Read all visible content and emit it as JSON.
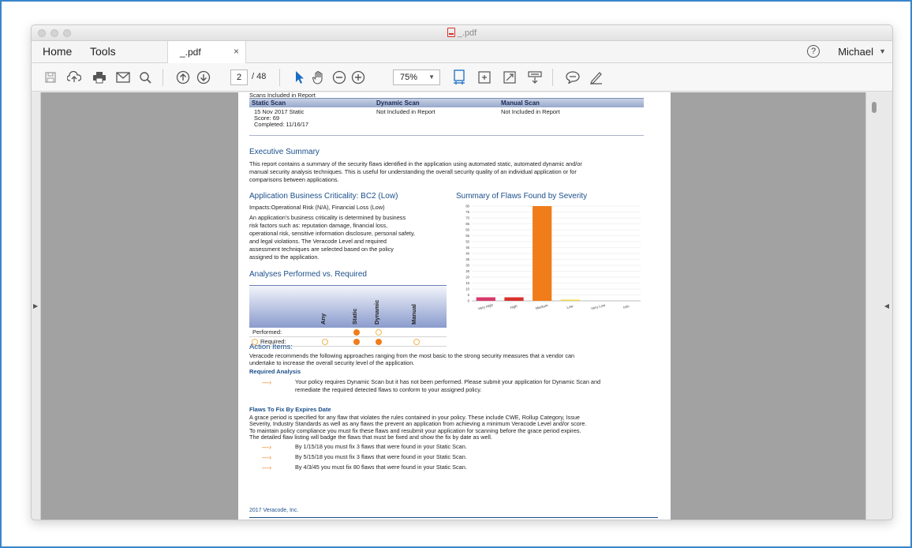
{
  "window": {
    "title": "_.pdf"
  },
  "nav": {
    "home": "Home",
    "tools": "Tools",
    "tab_label": "_.pdf",
    "tab_close": "×",
    "user": "Michael"
  },
  "toolbar": {
    "page_current": "2",
    "page_total": "/ 48",
    "zoom": "75%"
  },
  "document": {
    "scans_caption": "Scans Included in Report",
    "scan_headers": [
      "Static Scan",
      "Dynamic Scan",
      "Manual Scan"
    ],
    "static_scan_lines": [
      "15 Nov 2017 Static",
      "Score: 69",
      "Completed: 11/16/17"
    ],
    "dynamic_scan": "Not Included in Report",
    "manual_scan": "Not Included in Report",
    "exec_title": "Executive Summary",
    "exec_lines": [
      "This report contains a summary of the security flaws identified in the application using automated static, automated dynamic and/or",
      "manual security analysis techniques. This is useful for understanding the overall security quality of an individual application or for",
      "comparisons between applications."
    ],
    "criticality_title": "Application Business Criticality: BC2 (Low)",
    "impacts": "Impacts:Operational Risk (N/A), Financial Loss (Low)",
    "criticality_lines": [
      "An application's business criticality is determined by business",
      "risk factors such as: reputation damage, financial loss,",
      "operational risk, sensitive information disclosure, personal safety,",
      "and legal violations. The Veracode Level and required",
      "assessment techniques are selected based on the policy",
      "assigned to the application."
    ],
    "analyses_title": "Analyses Performed vs. Required",
    "analyses_cols": [
      "Any",
      "Static",
      "Dynamic",
      "Manual"
    ],
    "analyses_rows": [
      "Performed:",
      "Required:"
    ],
    "flaws_title": "Summary of Flaws Found by Severity",
    "action_title": "Action Items:",
    "action_lines": [
      "Veracode recommends the following approaches ranging from the most basic to the strong security measures that a vendor can",
      "undertake to increase the overall security level of the application."
    ],
    "required_analysis_title": "Required Analysis",
    "required_analysis_lines": [
      "Your policy requires Dynamic Scan but it has not been performed. Please submit your application for Dynamic Scan and",
      "remediate the required detected flaws to conform to your assigned policy."
    ],
    "flaws_fix_title": "Flaws To Fix By Expires Date",
    "flaws_fix_lines": [
      "A grace period is specified for any flaw that violates the rules contained in your policy. These include CWE, Rollup Category, Issue",
      "Severity, Industry Standards as well as any flaws the prevent an application from achieving a minimum Veracode Level and/or score.",
      "To maintain policy compliance you must fix these flaws and resubmit your application for scanning before the grace period expires.",
      "The detailed flaw listing will badge the flaws that must be fixed and show the fix by date as well."
    ],
    "fix_items": [
      "By 1/15/18 you must fix 3 flaws that were found in your Static Scan.",
      "By 5/15/18 you must fix 3 flaws that were found in your Static Scan.",
      "By 4/3/45 you must fix 80 flaws that were found in your Static Scan."
    ],
    "footer": "2017 Veracode, Inc."
  },
  "chart_data": {
    "type": "bar",
    "title": "Summary of Flaws Found by Severity",
    "categories": [
      "Very High",
      "High",
      "Medium",
      "Low",
      "Very Low",
      "Info"
    ],
    "values": [
      3,
      3,
      80,
      1,
      0,
      0
    ],
    "colors": [
      "#d83a6b",
      "#d8322c",
      "#f07d1a",
      "#f5d547",
      "#f5d547",
      "#f5d547"
    ],
    "ylim": [
      0,
      80
    ],
    "yticks": [
      0,
      5,
      10,
      15,
      20,
      25,
      30,
      35,
      40,
      45,
      50,
      55,
      60,
      65,
      70,
      75,
      80
    ],
    "grid": true
  },
  "analyses_marks": {
    "performed": [
      null,
      "fill",
      "ring",
      null
    ],
    "required": [
      "ring",
      "fill",
      "fill",
      "ring"
    ]
  }
}
